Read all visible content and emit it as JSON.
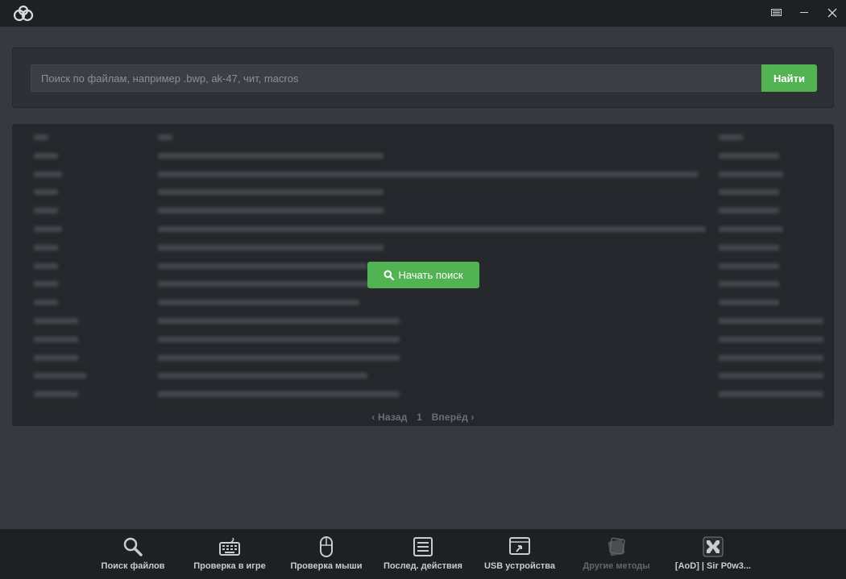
{
  "search": {
    "placeholder": "Поиск по файлам, например .bwp, ak-47, чит, macros",
    "value": "",
    "button_label": "Найти"
  },
  "results": {
    "start_button_label": "Начать поиск",
    "pager": {
      "prev_label": "‹ Назад",
      "page": "1",
      "next_label": "Вперёд ›"
    }
  },
  "nav": {
    "items": [
      {
        "label": "Поиск файлов",
        "icon": "search-icon"
      },
      {
        "label": "Проверка в игре",
        "icon": "keyboard-icon"
      },
      {
        "label": "Проверка мыши",
        "icon": "mouse-icon"
      },
      {
        "label": "Послед. действия",
        "icon": "list-icon"
      },
      {
        "label": "USB устройства",
        "icon": "usb-window-icon"
      },
      {
        "label": "Другие методы",
        "icon": "tools-icon",
        "disabled": true
      },
      {
        "label": "[AoD] | Sir P0w3...",
        "icon": "user-avatar-icon"
      }
    ]
  },
  "colors": {
    "accent": "#52b353",
    "titlebar": "#1e2023",
    "background": "#363a40",
    "panel": "#2d3035"
  }
}
